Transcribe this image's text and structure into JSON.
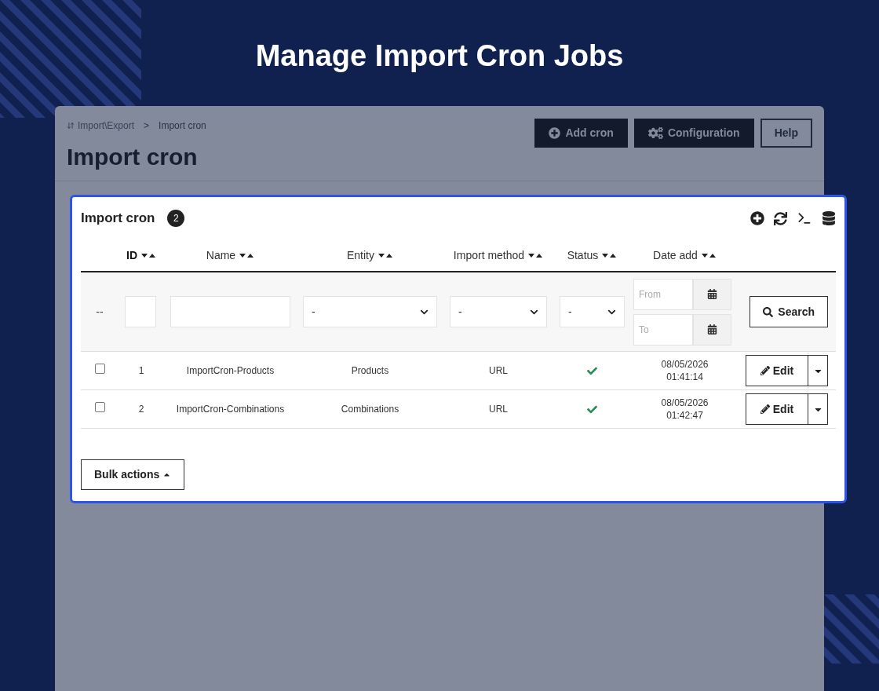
{
  "page_title": "Manage Import Cron Jobs",
  "breadcrumb": {
    "items": [
      {
        "label": "Import\\Export"
      },
      {
        "label": "Import cron"
      }
    ],
    "separator": ">"
  },
  "heading": "Import cron",
  "toolbar_buttons": [
    {
      "label": "Add cron",
      "kind": "add"
    },
    {
      "label": "Configuration",
      "kind": "configure"
    },
    {
      "label": "Help",
      "kind": "help"
    }
  ],
  "card": {
    "title": "Import cron",
    "count": "2"
  },
  "columns": [
    {
      "label": "ID",
      "sorted": true
    },
    {
      "label": "Name",
      "sorted": false
    },
    {
      "label": "Entity",
      "sorted": false
    },
    {
      "label": "Import method",
      "sorted": false
    },
    {
      "label": "Status",
      "sorted": false
    },
    {
      "label": "Date add",
      "sorted": false
    }
  ],
  "filters": {
    "reset": "--",
    "entity": "-",
    "import_method": "-",
    "status": "-",
    "date_from": {
      "placeholder": "From"
    },
    "date_to": {
      "placeholder": "To"
    },
    "search_button": "Search"
  },
  "rows": [
    {
      "checked": false,
      "id": "1",
      "name": "ImportCron-Products",
      "entity": "Products",
      "import_method": "URL",
      "active": true,
      "date": "08/05/2026",
      "time": "01:41:14",
      "edit": "Edit"
    },
    {
      "checked": false,
      "id": "2",
      "name": "ImportCron-Combinations",
      "entity": "Combinations",
      "import_method": "URL",
      "active": true,
      "date": "08/05/2026",
      "time": "01:42:47",
      "edit": "Edit"
    }
  ],
  "bulk_actions": "Bulk actions"
}
